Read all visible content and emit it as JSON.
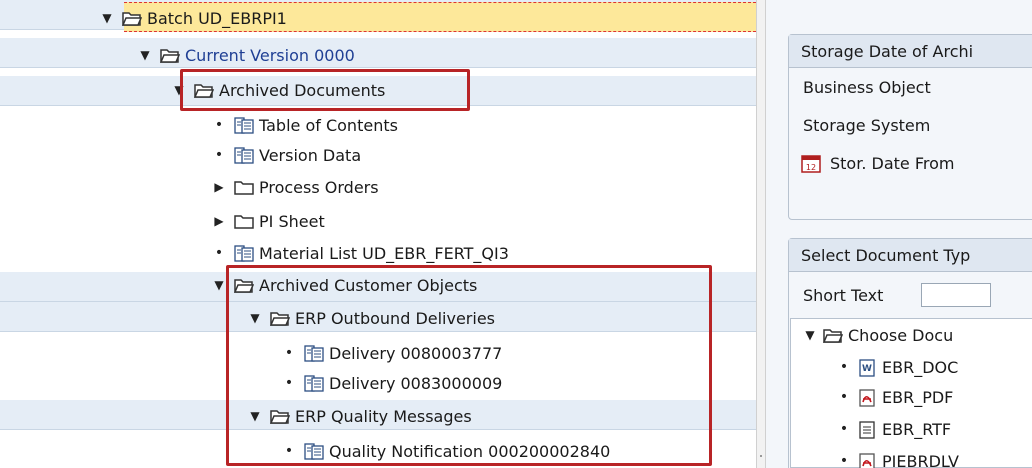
{
  "tree": {
    "root": {
      "label": "Batch UD_EBRPI1",
      "expander": "▼",
      "icon": "folder-open-icon"
    },
    "version": {
      "label": "Current Version 0000",
      "expander": "▼",
      "icon": "folder-open-icon"
    },
    "archived_documents": {
      "label": "Archived Documents",
      "expander": "▼",
      "icon": "folder-open-icon"
    },
    "table_of_contents": {
      "label": "Table of Contents",
      "marker": "•",
      "icon": "document-icon"
    },
    "version_data": {
      "label": "Version Data",
      "marker": "•",
      "icon": "document-icon"
    },
    "process_orders": {
      "label": "Process Orders",
      "expander": "▶",
      "icon": "folder-icon"
    },
    "pi_sheet": {
      "label": "PI Sheet",
      "expander": "▶",
      "icon": "folder-icon"
    },
    "material_list": {
      "label": "Material List UD_EBR_FERT_QI3",
      "marker": "•",
      "icon": "document-icon"
    },
    "archived_customer_objects": {
      "label": "Archived Customer Objects",
      "expander": "▼",
      "icon": "folder-open-icon"
    },
    "erp_outbound_deliveries": {
      "label": "ERP Outbound Deliveries",
      "expander": "▼",
      "icon": "folder-open-icon"
    },
    "delivery_1": {
      "label": "Delivery 0080003777",
      "marker": "•",
      "icon": "document-icon"
    },
    "delivery_2": {
      "label": "Delivery 0083000009",
      "marker": "•",
      "icon": "document-icon"
    },
    "erp_quality_messages": {
      "label": "ERP Quality Messages",
      "expander": "▼",
      "icon": "folder-open-icon"
    },
    "quality_notification": {
      "label": "Quality Notification 000200002840",
      "marker": "•",
      "icon": "document-icon"
    }
  },
  "right_panel": {
    "storage_frame": {
      "title": "Storage Date of Archi",
      "fields": [
        "Business Object",
        "Storage System"
      ],
      "date_field": {
        "label": "Stor. Date From",
        "icon": "calendar-icon"
      }
    },
    "doc_type_frame": {
      "title": "Select Document Typ",
      "short_text_label": "Short Text",
      "short_text_value": "",
      "tree": {
        "root": {
          "label": "Choose Docu",
          "expander": "▼",
          "icon": "folder-open-icon"
        },
        "items": [
          {
            "label": "EBR_DOC",
            "marker": "•",
            "icon": "word-doc-icon"
          },
          {
            "label": "EBR_PDF",
            "marker": "•",
            "icon": "pdf-icon"
          },
          {
            "label": "EBR_RTF",
            "marker": "•",
            "icon": "text-file-icon"
          },
          {
            "label": "PIEBRDLV",
            "marker": "•",
            "icon": "pdf-icon"
          }
        ]
      }
    }
  },
  "colors": {
    "selection": "#fde89a",
    "highlight_box": "#b82426",
    "row_band": "#e5edf6",
    "link": "#1f3f94"
  }
}
